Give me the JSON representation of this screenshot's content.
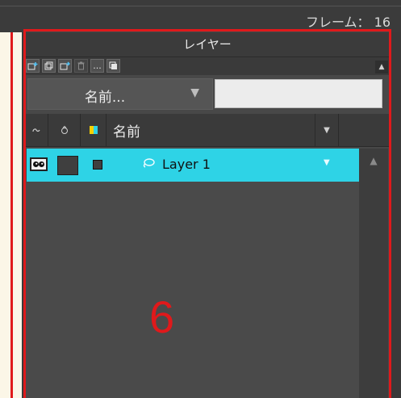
{
  "header": {
    "frame_label": "フレーム： 16"
  },
  "panel": {
    "title": "レイヤー",
    "toolbar": {
      "icons": [
        "new-layer-icon",
        "new-folder-icon",
        "new-layer-from-icon",
        "delete-icon",
        "more-icon",
        "layer-sync-icon"
      ],
      "more_text": "..."
    },
    "filter": {
      "select_label": "名前...",
      "input_value": ""
    },
    "columns": {
      "name_label": "名前"
    },
    "layers": [
      {
        "name": "Layer 1",
        "selected": true
      }
    ]
  },
  "annotation": {
    "number": "6",
    "color": "#e0191b"
  },
  "colors": {
    "accent": "#2ed3e6",
    "panel_bg": "#484848"
  }
}
